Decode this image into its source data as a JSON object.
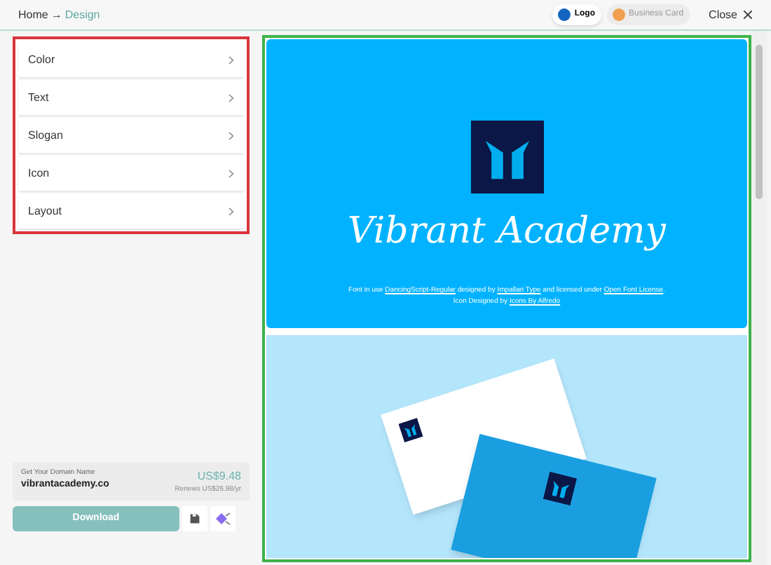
{
  "breadcrumb": {
    "home": "Home",
    "arrow": "→",
    "current": "Design"
  },
  "modes": [
    {
      "label": "Logo",
      "selected": true,
      "color": "#1565c0"
    },
    {
      "label": "Business Card",
      "selected": false,
      "color": "#f0a050"
    }
  ],
  "close": "Close",
  "menu": [
    {
      "label": "Color"
    },
    {
      "label": "Text"
    },
    {
      "label": "Slogan"
    },
    {
      "label": "Icon"
    },
    {
      "label": "Layout"
    }
  ],
  "domain": {
    "heading": "Get Your Domain Name",
    "name": "vibrantacademy.co",
    "price": "US$9.48",
    "renew": "Renews US$26.98/yr"
  },
  "download": "Download",
  "preview": {
    "title": "Vibrant Academy",
    "credits": [
      {
        "kind": "text",
        "text": "Font in use "
      },
      {
        "kind": "link",
        "text": "DancingScript-Regular"
      },
      {
        "kind": "text",
        "text": " designed by "
      },
      {
        "kind": "link",
        "text": "Impallari Type"
      },
      {
        "kind": "text",
        "text": " and licensed under "
      },
      {
        "kind": "link",
        "text": "Open Font License"
      },
      {
        "kind": "text",
        "text": ". Icon Designed by "
      },
      {
        "kind": "link",
        "text": "Icons By Alfredo"
      }
    ]
  }
}
